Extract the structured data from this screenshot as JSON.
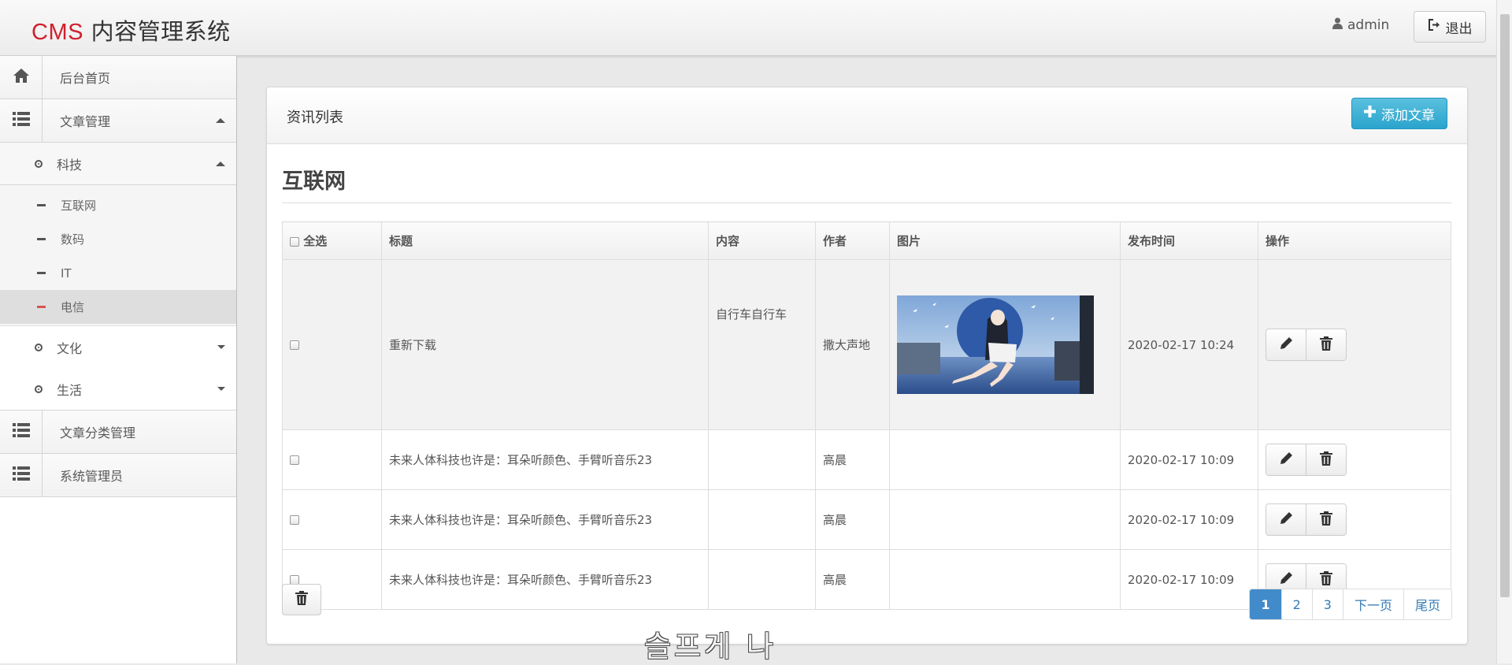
{
  "header": {
    "logo_brand": "CMS",
    "logo_system": "内容管理系统",
    "username": "admin",
    "logout_label": "退出"
  },
  "sidebar": {
    "home": "后台首页",
    "article_mgmt": "文章管理",
    "tech": "科技",
    "tech_children": [
      "互联网",
      "数码",
      "IT",
      "电信"
    ],
    "culture": "文化",
    "life": "生活",
    "category_mgmt": "文章分类管理",
    "admin_mgmt": "系统管理员"
  },
  "panel": {
    "title": "资讯列表",
    "add_label": "添加文章",
    "section_title": "互联网"
  },
  "table": {
    "headers": {
      "select_all": "全选",
      "title": "标题",
      "content": "内容",
      "author": "作者",
      "image": "图片",
      "published": "发布时间",
      "actions": "操作"
    },
    "rows": [
      {
        "title": "重新下载",
        "content": "自行车自行车",
        "author": "撒大声地",
        "published": "2020-02-17 10:24",
        "has_image": true
      },
      {
        "title": "未来人体科技也许是：耳朵听颜色、手臂听音乐23",
        "content": "",
        "author": "高晨",
        "published": "2020-02-17 10:09",
        "has_image": false
      },
      {
        "title": "未来人体科技也许是：耳朵听颜色、手臂听音乐23",
        "content": "",
        "author": "高晨",
        "published": "2020-02-17 10:09",
        "has_image": false
      },
      {
        "title": "未来人体科技也许是：耳朵听颜色、手臂听音乐23",
        "content": "",
        "author": "高晨",
        "published": "2020-02-17 10:09",
        "has_image": false
      }
    ]
  },
  "pagination": {
    "pages": [
      "1",
      "2",
      "3"
    ],
    "current": "1",
    "next": "下一页",
    "last": "尾页"
  },
  "overlay_text": "슬프게 나"
}
